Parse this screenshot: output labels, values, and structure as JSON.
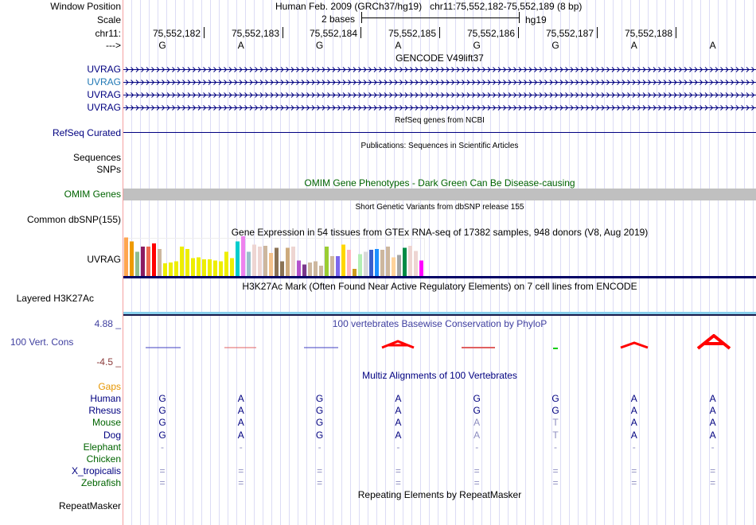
{
  "header": {
    "window_position_label": "Window Position",
    "window_position": "Human Feb. 2009 (GRCh37/hg19)   chr11:75,552,182-75,552,189 (8 bp)",
    "scale_label": "Scale",
    "scale_text": "2 bases",
    "assembly": "hg19",
    "chrom_label": "chr11:",
    "strand_label": "--->"
  },
  "ruler": {
    "positions": [
      "75,552,182",
      "75,552,183",
      "75,552,184",
      "75,552,185",
      "75,552,186",
      "75,552,187",
      "75,552,188"
    ],
    "bases": [
      "G",
      "A",
      "G",
      "A",
      "G",
      "G",
      "A",
      "A"
    ]
  },
  "tracks": {
    "gencode": {
      "title": "GENCODE V49lift37",
      "rows": [
        {
          "label": "UVRAG",
          "color": "#000080"
        },
        {
          "label": "UVRAG",
          "color": "#1f77b4"
        },
        {
          "label": "UVRAG",
          "color": "#000080"
        },
        {
          "label": "UVRAG",
          "color": "#000080"
        }
      ]
    },
    "refseq": {
      "title": "RefSeq genes from NCBI",
      "label": "RefSeq Curated",
      "color": "#000080"
    },
    "publications": {
      "title": "Publications: Sequences in Scientific Articles",
      "label1": "Sequences",
      "label2": "SNPs"
    },
    "omim": {
      "title": "OMIM Gene Phenotypes - Dark Green Can Be Disease-causing",
      "label": "OMIM Genes",
      "color": "#006400",
      "bar_color": "#c0c0c0"
    },
    "dbsnp": {
      "title": "Short Genetic Variants from dbSNP release 155",
      "label": "Common dbSNP(155)"
    },
    "gtex": {
      "title": "Gene Expression in 54 tissues from GTEx RNA-seq of 17382 samples, 948 donors (V8, Aug 2019)",
      "label": "UVRAG",
      "levels": [
        0.97,
        0.87,
        0.61,
        0.74,
        0.74,
        0.82,
        0.68,
        0.32,
        0.34,
        0.37,
        0.74,
        0.68,
        0.45,
        0.47,
        0.42,
        0.42,
        0.39,
        0.37,
        0.61,
        0.45,
        0.87,
        1,
        0.61,
        0.79,
        0.74,
        0.76,
        0.58,
        0.71,
        0.37,
        0.71,
        0.74,
        0.39,
        0.29,
        0.34,
        0.37,
        0.26,
        0.74,
        0.5,
        0.5,
        0.79,
        0.66,
        0.18,
        0.55,
        0.61,
        0.66,
        0.68,
        0.66,
        0.74,
        0.47,
        0.53,
        0.71,
        0.76,
        0.63,
        0.39
      ],
      "colors": [
        "#FFA54F",
        "#EE9A00",
        "#8FBC8F",
        "#8B1C62",
        "#EE6A50",
        "#FF0000",
        "#CDB79E",
        "#EEEE00",
        "#EEEE00",
        "#EEEE00",
        "#EEEE00",
        "#EEEE00",
        "#EEEE00",
        "#EEEE00",
        "#EEEE00",
        "#EEEE00",
        "#EEEE00",
        "#EEEE00",
        "#EEEE00",
        "#EEEE00",
        "#00CDCD",
        "#EE82EE",
        "#9AC0CD",
        "#EED5D2",
        "#EED5D2",
        "#CDB79E",
        "#F4C28C",
        "#8B7355",
        "#8B7355",
        "#CDAA7D",
        "#EED5D2",
        "#B452CD",
        "#7A378B",
        "#CDB79E",
        "#CDB79E",
        "#CDB79E",
        "#9ACD32",
        "#CDB79E",
        "#7B68EE",
        "#FFD700",
        "#FFB6C1",
        "#CD9B1D",
        "#B4EEB4",
        "#D9D9D9",
        "#3A5FCD",
        "#1E90FF",
        "#CDB79E",
        "#CDB79E",
        "#FFD39B",
        "#A6A6A6",
        "#008B45",
        "#EED5D2",
        "#EED5D2",
        "#FF00FF"
      ]
    },
    "h3k27ac": {
      "title": "H3K27Ac Mark (Often Found Near Active Regulatory Elements) on 7 cell lines from ENCODE",
      "label": "Layered H3K27Ac"
    },
    "phylop": {
      "title": "100 vertebrates Basewise Conservation by PhyloP",
      "label": "100 Vert. Cons",
      "max": "4.88 _",
      "min": "-4.5 _",
      "color": "#4040a0"
    },
    "multiz": {
      "title": "Multiz Alignments of 100 Vertebrates",
      "gaps_label": "Gaps",
      "species": [
        {
          "name": "Human",
          "color": "#000080",
          "bases": [
            "G",
            "A",
            "G",
            "A",
            "G",
            "G",
            "A",
            "A"
          ]
        },
        {
          "name": "Rhesus",
          "color": "#000080",
          "bases": [
            "G",
            "A",
            "G",
            "A",
            "G",
            "G",
            "A",
            "A"
          ]
        },
        {
          "name": "Mouse",
          "color": "#006400",
          "bases": [
            "G",
            "A",
            "G",
            "A",
            "A",
            "T",
            "A",
            "A"
          ]
        },
        {
          "name": "Dog",
          "color": "#000080",
          "bases": [
            "G",
            "A",
            "G",
            "A",
            "A",
            "T",
            "A",
            "A"
          ]
        },
        {
          "name": "Elephant",
          "color": "#006400",
          "bases": [
            "-",
            "-",
            "-",
            "-",
            "-",
            "-",
            "-",
            "-"
          ]
        },
        {
          "name": "Chicken",
          "color": "#006400",
          "bases": [
            "",
            "",
            "",
            "",
            "",
            "",
            "",
            ""
          ]
        },
        {
          "name": "X_tropicalis",
          "color": "#000080",
          "bases": [
            "=",
            "=",
            "=",
            "=",
            "=",
            "=",
            "=",
            "="
          ]
        },
        {
          "name": "Zebrafish",
          "color": "#006400",
          "bases": [
            "=",
            "=",
            "=",
            "=",
            "=",
            "=",
            "=",
            "="
          ]
        }
      ]
    },
    "repeatmasker": {
      "title": "Repeating Elements by RepeatMasker",
      "label": "RepeatMasker"
    }
  }
}
